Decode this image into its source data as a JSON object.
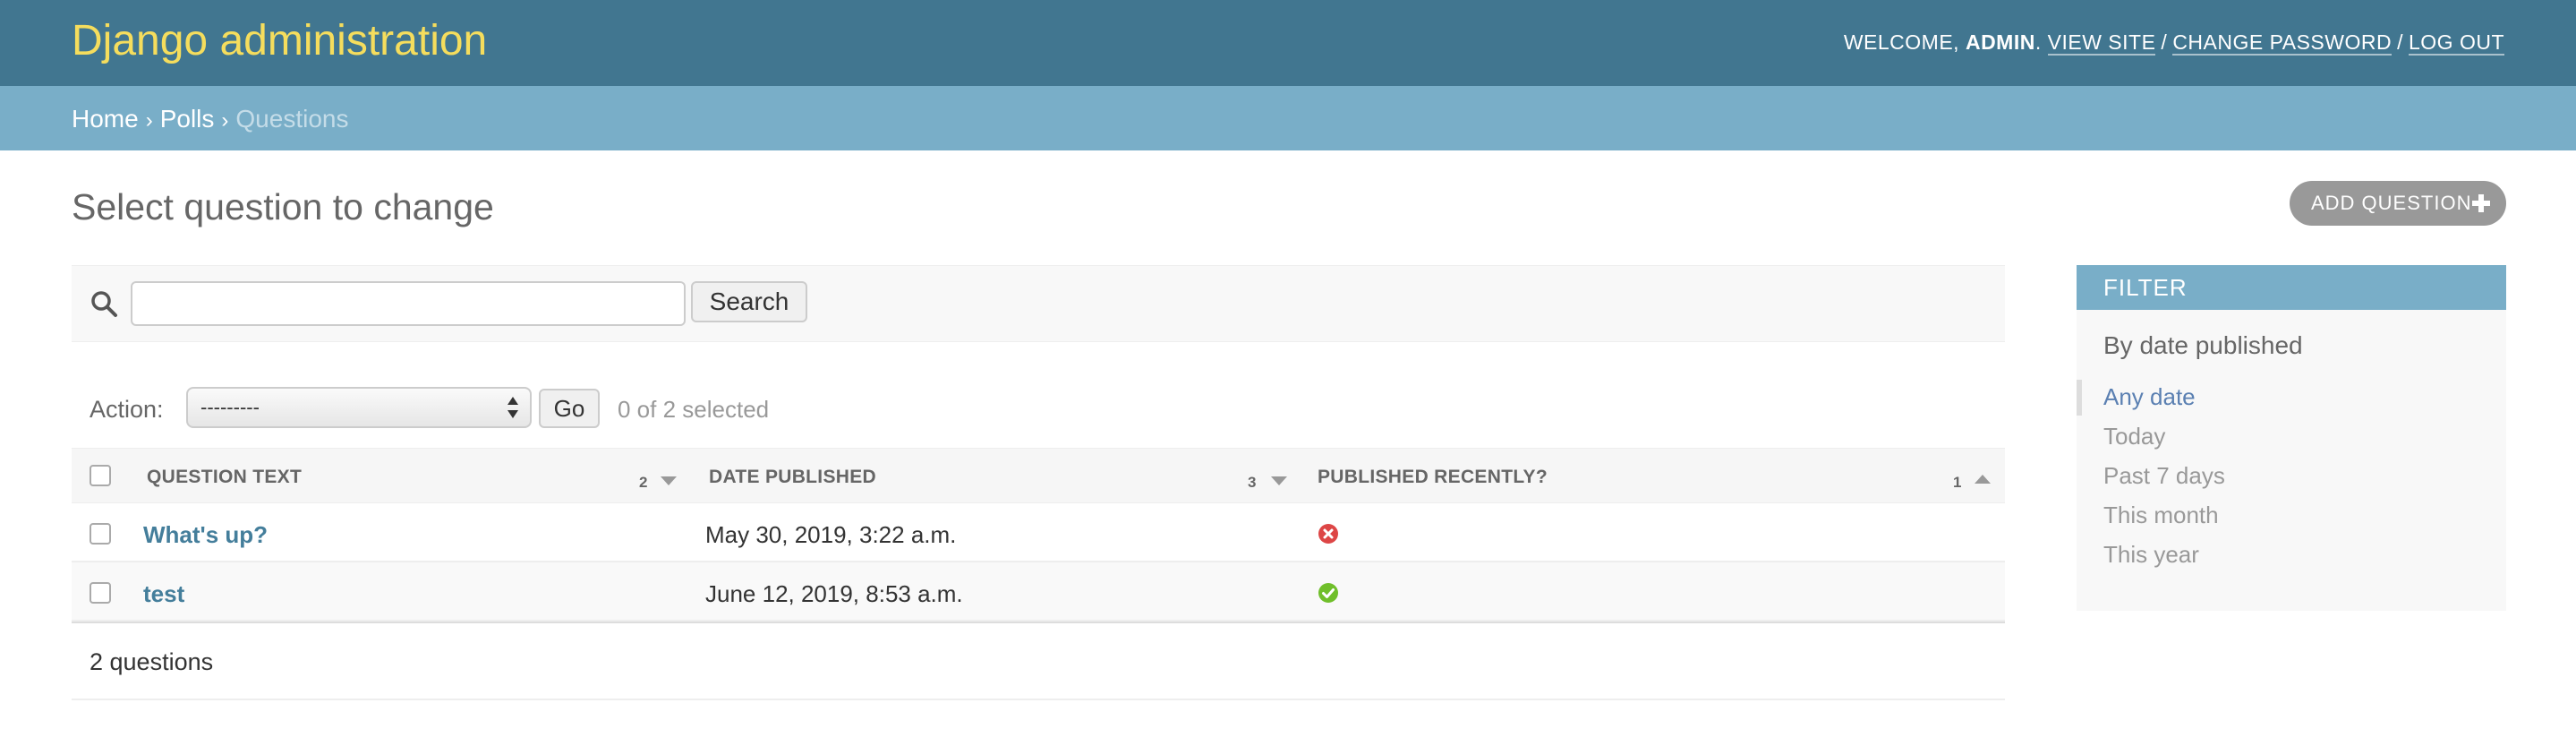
{
  "header": {
    "site_name": "Django administration",
    "welcome": "WELCOME,",
    "user": "ADMIN",
    "view_site": "VIEW SITE",
    "change_password": "CHANGE PASSWORD",
    "log_out": "LOG OUT"
  },
  "breadcrumbs": {
    "home": "Home",
    "app": "Polls",
    "current": "Questions"
  },
  "page": {
    "title": "Select question to change",
    "add_button": "ADD QUESTION"
  },
  "search": {
    "value": "",
    "button": "Search"
  },
  "actions": {
    "label": "Action:",
    "selected_option": "---------",
    "go": "Go",
    "selected_count": "0 of 2 selected"
  },
  "table": {
    "columns": [
      {
        "label": "QUESTION TEXT",
        "sort_priority": "2",
        "sort_dir": "desc"
      },
      {
        "label": "DATE PUBLISHED",
        "sort_priority": "3",
        "sort_dir": "desc"
      },
      {
        "label": "PUBLISHED RECENTLY?",
        "sort_priority": "1",
        "sort_dir": "asc"
      }
    ],
    "rows": [
      {
        "question": "What's up?",
        "date": "May 30, 2019, 3:22 a.m.",
        "recent": false
      },
      {
        "question": "test",
        "date": "June 12, 2019, 8:53 a.m.",
        "recent": true
      }
    ],
    "count": "2 questions"
  },
  "filter": {
    "title": "FILTER",
    "subtitle": "By date published",
    "options": [
      {
        "label": "Any date",
        "selected": true
      },
      {
        "label": "Today",
        "selected": false
      },
      {
        "label": "Past 7 days",
        "selected": false
      },
      {
        "label": "This month",
        "selected": false
      },
      {
        "label": "This year",
        "selected": false
      }
    ]
  },
  "colors": {
    "header_bg": "#417690",
    "breadcrumb_bg": "#79aec8",
    "brand_yellow": "#f5dd5d",
    "link": "#447e9b",
    "icon_no": "#dd4646",
    "icon_yes": "#70bf2b"
  }
}
